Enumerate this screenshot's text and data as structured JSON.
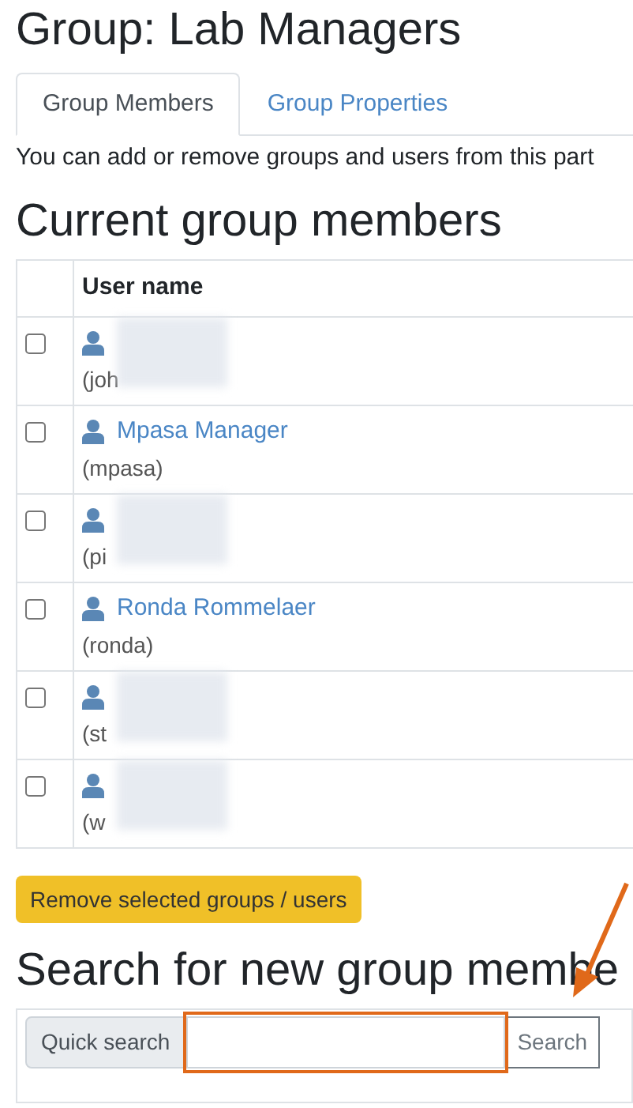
{
  "title": "Group: Lab Managers",
  "tabs": [
    {
      "label": "Group Members",
      "selected": true
    },
    {
      "label": "Group Properties",
      "selected": false
    }
  ],
  "intro": "You can add or remove groups and users from this part",
  "members_heading": "Current group members",
  "table": {
    "columns": [
      "User name"
    ],
    "rows": [
      {
        "login": "(joh",
        "blurred": true,
        "checked": false
      },
      {
        "name": "Mpasa Manager",
        "login": "(mpasa)",
        "blurred": false,
        "checked": false
      },
      {
        "login": "(pi",
        "blurred": true,
        "checked": false
      },
      {
        "name": "Ronda Rommelaer",
        "login": "(ronda)",
        "blurred": false,
        "checked": false
      },
      {
        "login": "(st",
        "blurred": true,
        "checked": false
      },
      {
        "login": "(w",
        "blurred": true,
        "checked": false
      }
    ]
  },
  "remove_button": "Remove selected groups / users",
  "search_heading": "Search for new group membe",
  "search": {
    "label": "Quick search",
    "button": "Search"
  },
  "annotations": {
    "highlight_box": true,
    "arrow": true
  }
}
